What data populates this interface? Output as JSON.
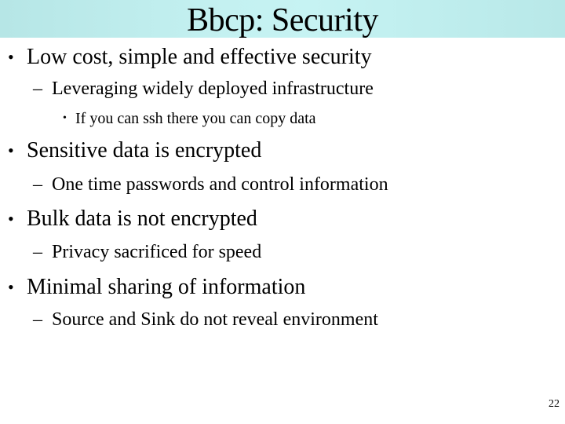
{
  "slide": {
    "title": "Bbcp: Security",
    "page_number": "22",
    "bullets": [
      {
        "level": 1,
        "marker": "•",
        "text": "Low cost, simple and effective security"
      },
      {
        "level": 2,
        "marker": "–",
        "text": "Leveraging widely deployed infrastructure"
      },
      {
        "level": 3,
        "marker": "•",
        "text": "If you can ssh there you can copy data"
      },
      {
        "level": 1,
        "marker": "•",
        "text": "Sensitive data is encrypted"
      },
      {
        "level": 2,
        "marker": "–",
        "text": "One time passwords and control information"
      },
      {
        "level": 1,
        "marker": "•",
        "text": "Bulk data is not encrypted"
      },
      {
        "level": 2,
        "marker": "–",
        "text": "Privacy sacrificed for speed"
      },
      {
        "level": 1,
        "marker": "•",
        "text": "Minimal sharing of information"
      },
      {
        "level": 2,
        "marker": "–",
        "text": "Source and Sink do not reveal environment"
      }
    ]
  },
  "colors": {
    "title_bar": "#c4f1f1",
    "text": "#000000",
    "background": "#ffffff"
  }
}
